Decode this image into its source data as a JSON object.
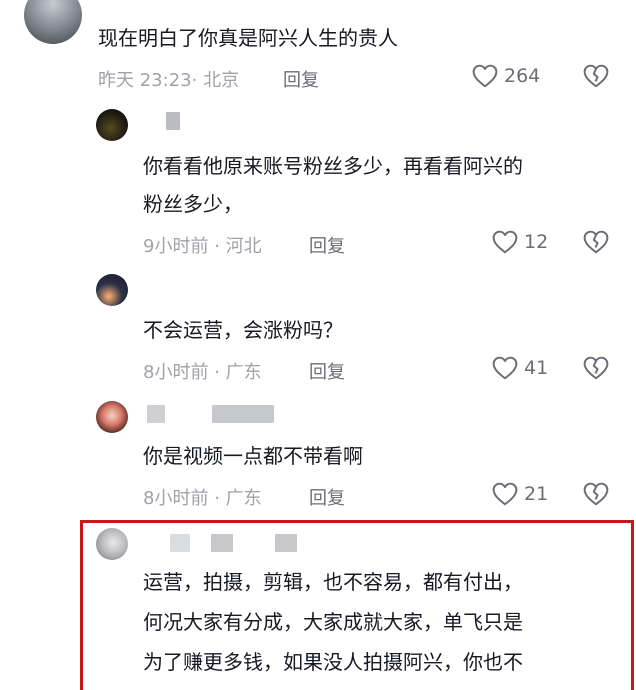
{
  "comments": [
    {
      "text_lines": [
        "现在明白了你真是阿兴人生的贵人"
      ],
      "time": "昨天 23:23",
      "sep": "·",
      "location": "北京",
      "reply_label": "回复",
      "likes": "264"
    },
    {
      "text_lines": [
        "你看看他原来账号粉丝多少，再看看阿兴的",
        "粉丝多少，"
      ],
      "time": "9小时前",
      "sep": "·",
      "location": "河北",
      "reply_label": "回复",
      "likes": "12"
    },
    {
      "text_lines": [
        "不会运营，会涨粉吗？"
      ],
      "time": "8小时前",
      "sep": "·",
      "location": "广东",
      "reply_label": "回复",
      "likes": "41"
    },
    {
      "text_lines": [
        "你是视频一点都不带看啊"
      ],
      "time": "8小时前",
      "sep": "·",
      "location": "广东",
      "reply_label": "回复",
      "likes": "21"
    },
    {
      "text_lines": [
        "运营，拍摄，剪辑，也不容易，都有付出，",
        "何况大家有分成，大家成就大家，单飞只是",
        "为了赚更多钱，如果没人拍摄阿兴，你也不"
      ]
    }
  ],
  "colors": {
    "text": "#161823",
    "meta": "#a0a2a8",
    "highlight_border": "#c4191b"
  },
  "icons": [
    "heart-icon",
    "broken-heart-icon"
  ]
}
